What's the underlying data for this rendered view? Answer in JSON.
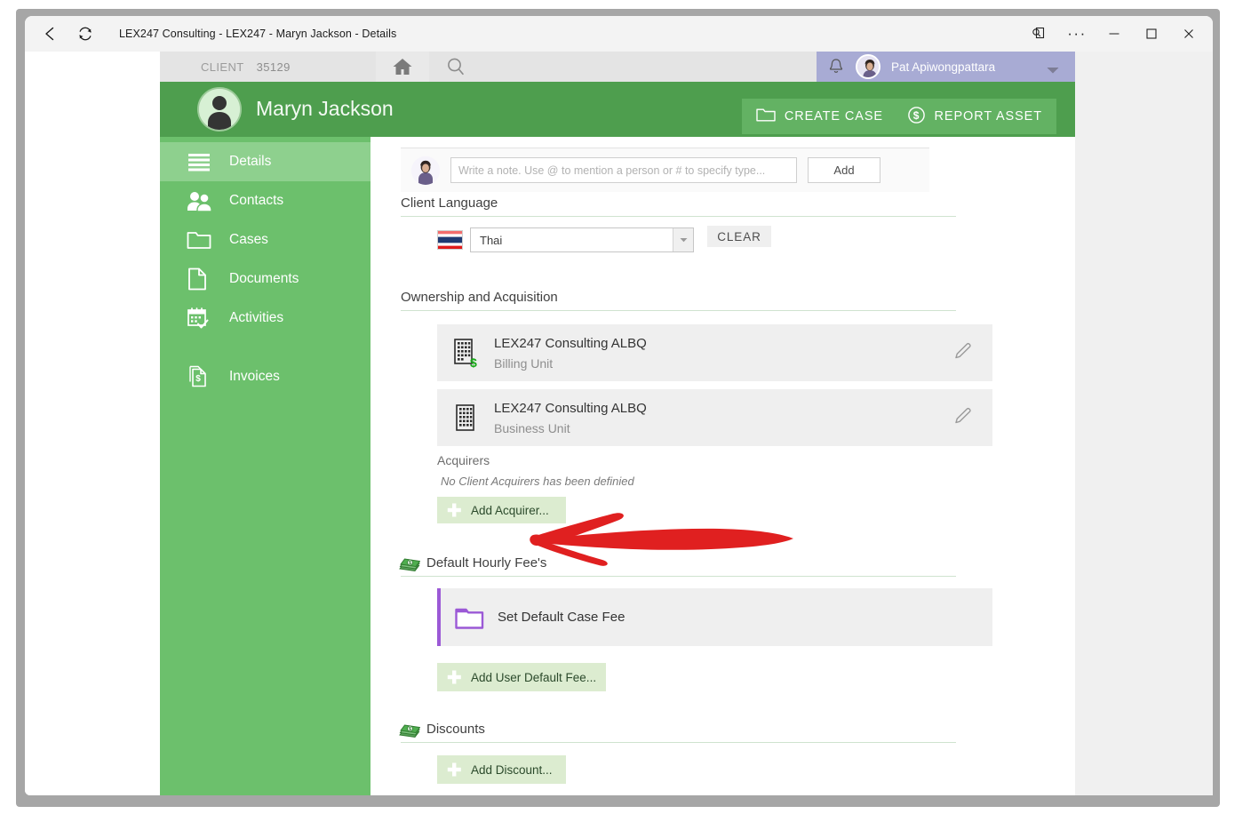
{
  "window": {
    "titlebar": {
      "title": "LEX247 Consulting - LEX247 - Maryn Jackson - Details",
      "back_icon": "back-arrow-icon",
      "refresh_icon": "refresh-icon",
      "reading_view_icon": "reading-view-icon",
      "more_label": "···",
      "minimize_label": "─",
      "maximize_label": "□",
      "close_label": "✕"
    }
  },
  "topbar": {
    "record_type": "CLIENT",
    "record_number": "35129",
    "home_icon": "home-icon",
    "search_icon": "search-icon",
    "notification_icon": "bell-icon",
    "user_name": "Pat Apiwongpattara",
    "user_menu_icon": "chevron-down-icon",
    "user_bar_color": "#a8abd4"
  },
  "header": {
    "person_name": "Maryn Jackson",
    "avatar_icon": "person-avatar-icon",
    "buttons": [
      {
        "label": "CREATE CASE",
        "icon": "folder-icon",
        "name": "create-case-button"
      },
      {
        "label": "REPORT ASSET",
        "icon": "dollar-circle-icon",
        "name": "report-asset-button"
      }
    ],
    "bg_color": "#4e9e4e",
    "button_color": "#63b263"
  },
  "sidebar": {
    "bg_color": "#6cc06c",
    "active_color": "#8ed08e",
    "items": [
      {
        "label": "Details",
        "icon": "list-lines-icon",
        "active": true
      },
      {
        "label": "Contacts",
        "icon": "people-icon",
        "active": false
      },
      {
        "label": "Cases",
        "icon": "folder-icon",
        "active": false
      },
      {
        "label": "Documents",
        "icon": "document-icon",
        "active": false
      },
      {
        "label": "Activities",
        "icon": "calendar-check-icon",
        "active": false
      },
      {
        "label": "Invoices",
        "icon": "invoice-dollar-icon",
        "active": false
      }
    ]
  },
  "content": {
    "note_composer": {
      "avatar_icon": "user-photo-icon",
      "placeholder": "Write a note. Use @ to mention a person or # to specify type...",
      "value": "",
      "add_label": "Add"
    },
    "client_language": {
      "section_title": "Client Language",
      "flag_icon": "thailand-flag-icon",
      "selected": "Thai",
      "dropdown_icon": "caret-down-icon",
      "clear_label": "CLEAR"
    },
    "ownership": {
      "section_title": "Ownership and Acquisition",
      "rows": [
        {
          "title": "LEX247 Consulting ALBQ",
          "subtitle": "Billing Unit",
          "icon": "building-dollar-icon",
          "edit_icon": "pencil-icon"
        },
        {
          "title": "LEX247 Consulting ALBQ",
          "subtitle": "Business Unit",
          "icon": "building-icon",
          "edit_icon": "pencil-icon"
        }
      ],
      "acquirers_label": "Acquirers",
      "acquirers_empty": "No Client Acquirers has been definied",
      "add_acquirer_label": "Add Acquirer...",
      "add_acquirer_icon": "plus-icon"
    },
    "default_hourly_fees": {
      "section_title": "Default Hourly Fee's",
      "section_icon": "money-stack-icon",
      "rows": [
        {
          "title": "Set Default Case Fee",
          "icon": "folder-purple-icon",
          "accent": "#9b59d6"
        }
      ],
      "add_label": "Add User Default Fee...",
      "add_icon": "plus-icon"
    },
    "discounts": {
      "section_title": "Discounts",
      "section_icon": "money-stack-icon",
      "add_label": "Add Discount...",
      "add_icon": "plus-icon"
    }
  },
  "annotation": {
    "arrow_color": "#e02020",
    "arrow_target": "Add Acquirer..."
  }
}
